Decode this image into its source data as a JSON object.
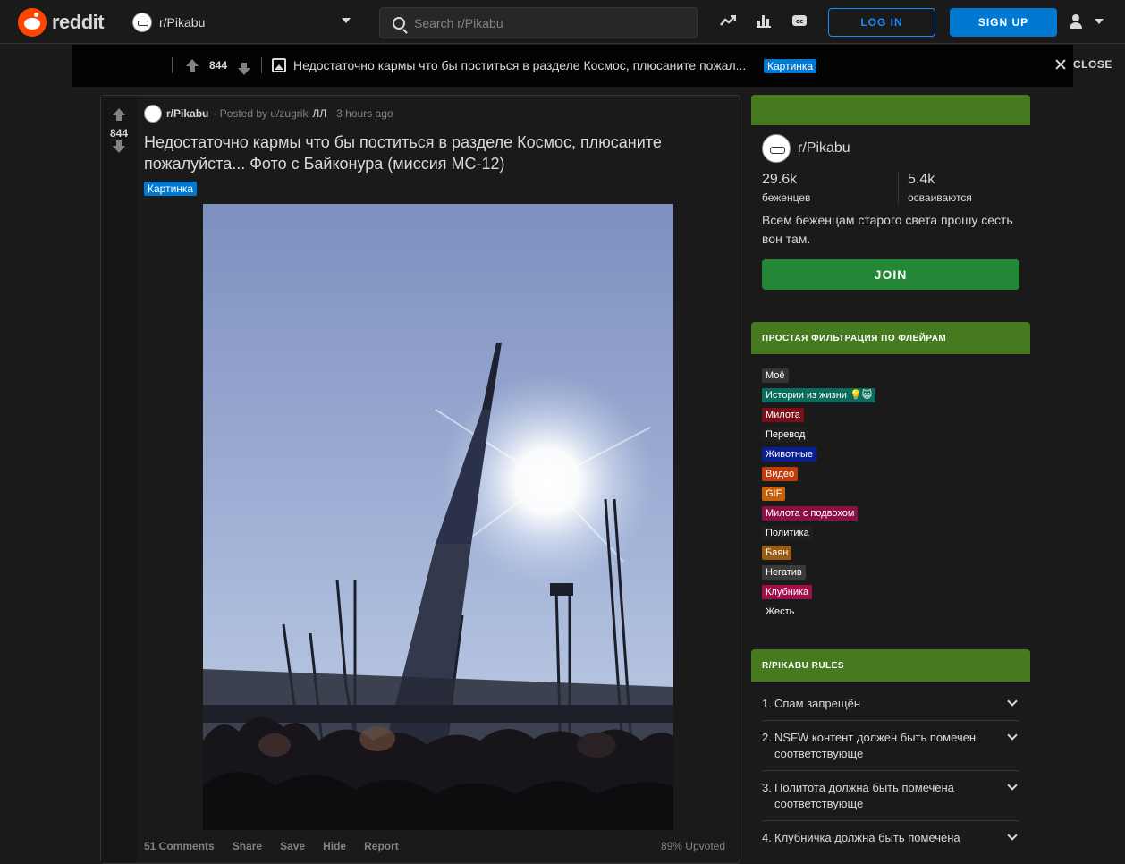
{
  "header": {
    "logo_text": "reddit",
    "subreddit": "r/Pikabu",
    "search_placeholder": "Search r/Pikabu",
    "login_label": "LOG IN",
    "signup_label": "SIGN UP",
    "icons": [
      "trending-icon",
      "stats-icon",
      "cc-icon"
    ]
  },
  "sticky": {
    "score": "844",
    "title": "Недостаточно кармы что бы поститься в разделе Космос, плюсаните пожал...",
    "flair": "Картинка",
    "close_label": "CLOSE"
  },
  "post": {
    "score": "844",
    "subreddit": "r/Pikabu",
    "posted_by": "· Posted by u/zugrik",
    "user_flair": "ЛЛ",
    "time": "3 hours ago",
    "title": "Недостаточно кармы что бы поститься в разделе Космос, плюсаните пожалуйста... Фото с Байконура (миссия МС-12)",
    "flair": "Картинка",
    "flair_color": "#0079d3",
    "footer": {
      "comments": "51 Comments",
      "share": "Share",
      "save": "Save",
      "hide": "Hide",
      "report": "Report",
      "upvoted": "89% Upvoted"
    }
  },
  "sidebar": {
    "about": {
      "name": "r/Pikabu",
      "members_num": "29.6k",
      "members_label": "беженцев",
      "online_num": "5.4k",
      "online_label": "осваиваются",
      "description": "Всем беженцам старого света прошу сесть вон там.",
      "join_label": "JOIN"
    },
    "filter": {
      "title": "ПРОСТАЯ ФИЛЬТРАЦИЯ ПО ФЛЕЙРАМ",
      "items": [
        {
          "label": "Моё",
          "color": "#343536"
        },
        {
          "label": "Истории из жизни 💡😺",
          "color": "#0b6b5c"
        },
        {
          "label": "Милота",
          "color": "#7a0f1a"
        },
        {
          "label": "Перевод",
          "color": "#1f1f20"
        },
        {
          "label": "Животные",
          "color": "#0a1f8f"
        },
        {
          "label": "Видео",
          "color": "#c23b0a"
        },
        {
          "label": "GIF",
          "color": "#c8600a"
        },
        {
          "label": "Милота с подвохом",
          "color": "#8a0f45"
        },
        {
          "label": "Политика",
          "color": "#1f1f20"
        },
        {
          "label": "Баян",
          "color": "#9a5b12"
        },
        {
          "label": "Негатив",
          "color": "#3a3a3b"
        },
        {
          "label": "Клубника",
          "color": "#a00f4a"
        },
        {
          "label": "Жесть",
          "color": "#1a1a1b"
        }
      ]
    },
    "rules": {
      "title": "R/PIKABU RULES",
      "items": [
        {
          "num": "1.",
          "text": "Спам запрещён"
        },
        {
          "num": "2.",
          "text": "NSFW контент должен быть помечен соответствующе"
        },
        {
          "num": "3.",
          "text": "Политота должна быть помечена соответствующе"
        },
        {
          "num": "4.",
          "text": "Клубничка должна быть помечена"
        }
      ]
    }
  },
  "colors": {
    "background": "#1a1a1b",
    "accent_green": "#467a1f",
    "join_green": "#238737",
    "login_blue": "#1a8cff",
    "signup_blue": "#0079d3"
  }
}
